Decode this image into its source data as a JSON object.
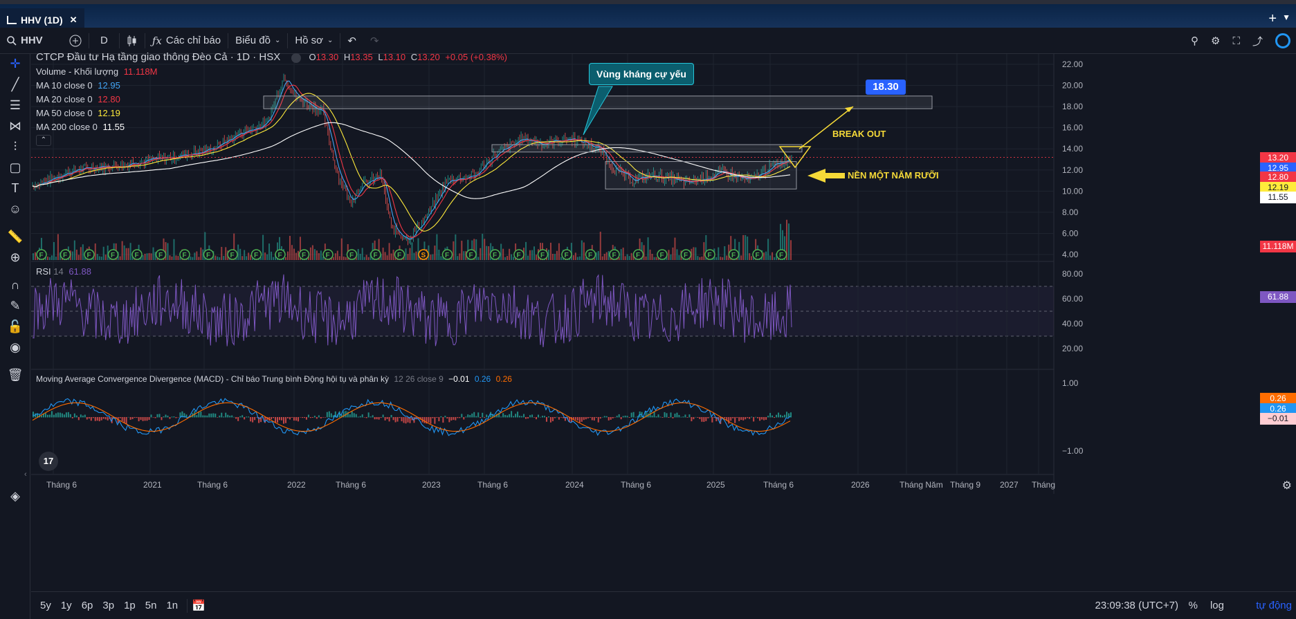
{
  "window": {
    "tab_title": "HHV (1D)",
    "close_glyph": "✕",
    "add_glyph": "+"
  },
  "toolbar": {
    "symbol": "HHV",
    "interval": "D",
    "indicators_label": "Các chỉ báo",
    "chart_type_label": "Biểu đồ",
    "profile_label": "Hồ sơ"
  },
  "legend": {
    "title": "CTCP Đầu tư Hạ tầng giao thông Đèo Cả · 1D · HSX",
    "ohlc": {
      "o_label": "O",
      "o": "13.30",
      "h_label": "H",
      "h": "13.35",
      "l_label": "L",
      "l": "13.10",
      "c_label": "C",
      "c": "13.20",
      "chg": "+0.05 (+0.38%)"
    },
    "volume_label": "Volume - Khối lượng",
    "volume_value": "11.118M",
    "ma10_label": "MA 10 close 0",
    "ma10_value": "12.95",
    "ma20_label": "MA 20 close 0",
    "ma20_value": "12.80",
    "ma50_label": "MA 50 close 0",
    "ma50_value": "12.19",
    "ma200_label": "MA 200 close 0",
    "ma200_value": "11.55",
    "rsi_label": "RSI",
    "rsi_len": "14",
    "rsi_value": "61.88",
    "macd_label": "Moving Average Convergence Divergence (MACD) - Chỉ báo Trung bình Động hội tụ và phân kỳ",
    "macd_params": "12 26 close 9",
    "macd_hist": "−0.01",
    "macd_line": "0.26",
    "macd_signal": "0.26"
  },
  "annotations": {
    "resistance_note": "Vùng kháng cự yếu",
    "target": "18.30",
    "breakout": "BREAK OUT",
    "base_note": "NỀN MỘT NĂM RƯỠI"
  },
  "price_axis": [
    "22.00",
    "20.00",
    "18.00",
    "16.00",
    "14.00",
    "12.00",
    "10.00",
    "8.00",
    "6.00",
    "4.00"
  ],
  "price_labels": {
    "last": "13.20",
    "ma10": "12.95",
    "ma20": "12.80",
    "ma50": "12.19",
    "ma200": "11.55",
    "volume": "11.118M"
  },
  "rsi_axis": [
    "80.00",
    "60.00",
    "40.00",
    "20.00"
  ],
  "macd_axis": [
    "1.00",
    "−1.00"
  ],
  "macd_labels": {
    "signal": "0.26",
    "macd": "0.26",
    "hist": "−0.01"
  },
  "time_axis": [
    "Tháng 6",
    "2021",
    "Tháng 6",
    "2022",
    "Tháng 6",
    "2023",
    "Tháng 6",
    "2024",
    "Tháng 6",
    "2025",
    "Tháng 6",
    "2026",
    "Tháng Năm",
    "Tháng 9",
    "2027",
    "Tháng"
  ],
  "bottom": {
    "ranges": [
      "5y",
      "1y",
      "6p",
      "3p",
      "1p",
      "5n",
      "1n"
    ],
    "clock": "23:09:38 (UTC+7)",
    "pct": "%",
    "log": "log",
    "auto": "tự động"
  },
  "event_marks": [
    "F",
    "F",
    "F",
    "F",
    "F",
    "F",
    "F",
    "F",
    "F",
    "F",
    "F",
    "F",
    "F",
    "F",
    "F",
    "F",
    "S",
    "F",
    "F",
    "F",
    "F",
    "F",
    "F",
    "F",
    "F",
    "F",
    "F",
    "F",
    "F",
    "F",
    "F",
    "F"
  ],
  "colors": {
    "bg": "#131722",
    "grid": "#1f2430",
    "up": "#26a69a",
    "down": "#ef5350",
    "ma10": "#2962ff",
    "ma20": "#f23645",
    "ma50": "#ffeb3b",
    "ma200": "#ffffff",
    "rsi": "#7e57c2",
    "macd": "#2196f3",
    "signal": "#ff6d00",
    "annotation": "#f5d938",
    "target_bg": "#2962ff"
  }
}
